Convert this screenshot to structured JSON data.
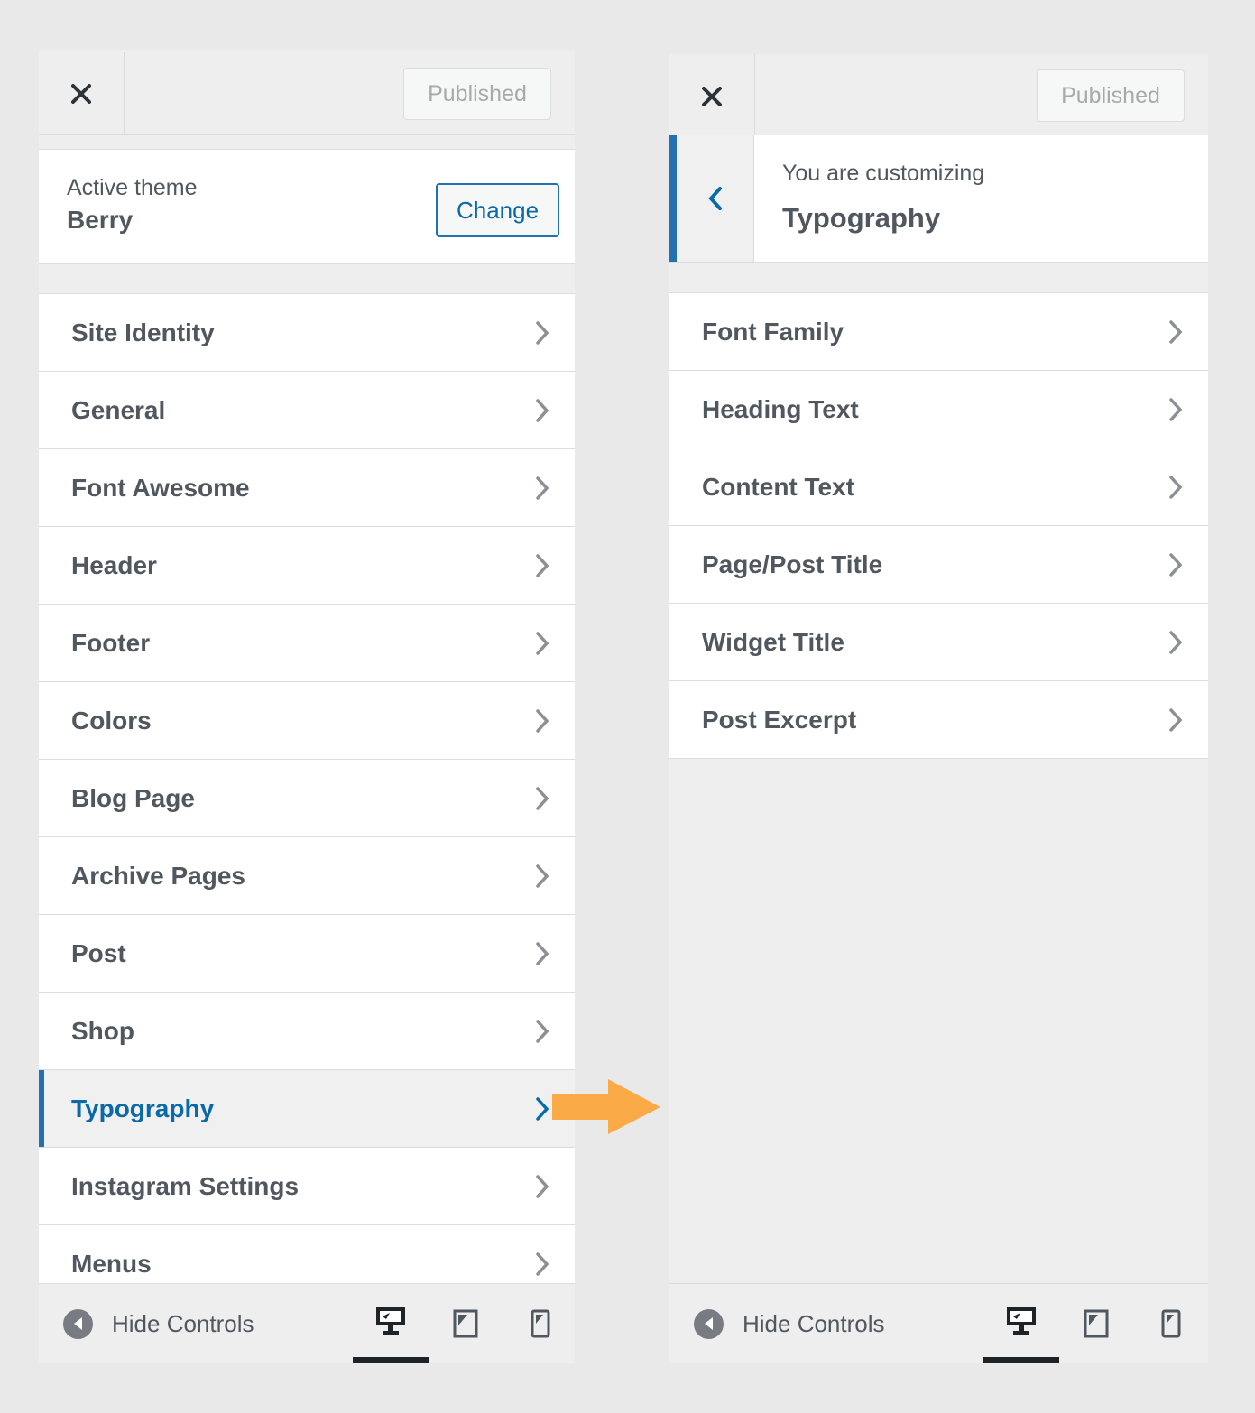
{
  "left_panel": {
    "close_label": "Close",
    "publish_label": "Published",
    "active_theme_label": "Active theme",
    "theme_name": "Berry",
    "change_label": "Change",
    "menu_items": [
      {
        "label": "Site Identity"
      },
      {
        "label": "General"
      },
      {
        "label": "Font Awesome"
      },
      {
        "label": "Header"
      },
      {
        "label": "Footer"
      },
      {
        "label": "Colors"
      },
      {
        "label": "Blog Page"
      },
      {
        "label": "Archive Pages"
      },
      {
        "label": "Post"
      },
      {
        "label": "Shop"
      },
      {
        "label": "Typography",
        "active": true
      },
      {
        "label": "Instagram Settings"
      },
      {
        "label": "Menus"
      }
    ],
    "hide_controls_label": "Hide Controls"
  },
  "right_panel": {
    "publish_label": "Published",
    "customizing_label": "You are customizing",
    "section_title": "Typography",
    "menu_items": [
      {
        "label": "Font Family"
      },
      {
        "label": "Heading Text"
      },
      {
        "label": "Content Text"
      },
      {
        "label": "Page/Post Title"
      },
      {
        "label": "Widget Title"
      },
      {
        "label": "Post Excerpt"
      }
    ],
    "hide_controls_label": "Hide Controls"
  },
  "icons": {
    "close": "close-icon",
    "chevron": "chevron-right-icon",
    "back": "chevron-left-icon",
    "collapse": "collapse-circle-icon",
    "desktop": "desktop-icon",
    "tablet": "tablet-icon",
    "mobile": "mobile-icon",
    "annotation_arrow": "arrow-right-icon"
  },
  "colors": {
    "accent": "#2271b1",
    "active_text": "#0a6aa8",
    "annotation_arrow": "#fbaa48"
  }
}
